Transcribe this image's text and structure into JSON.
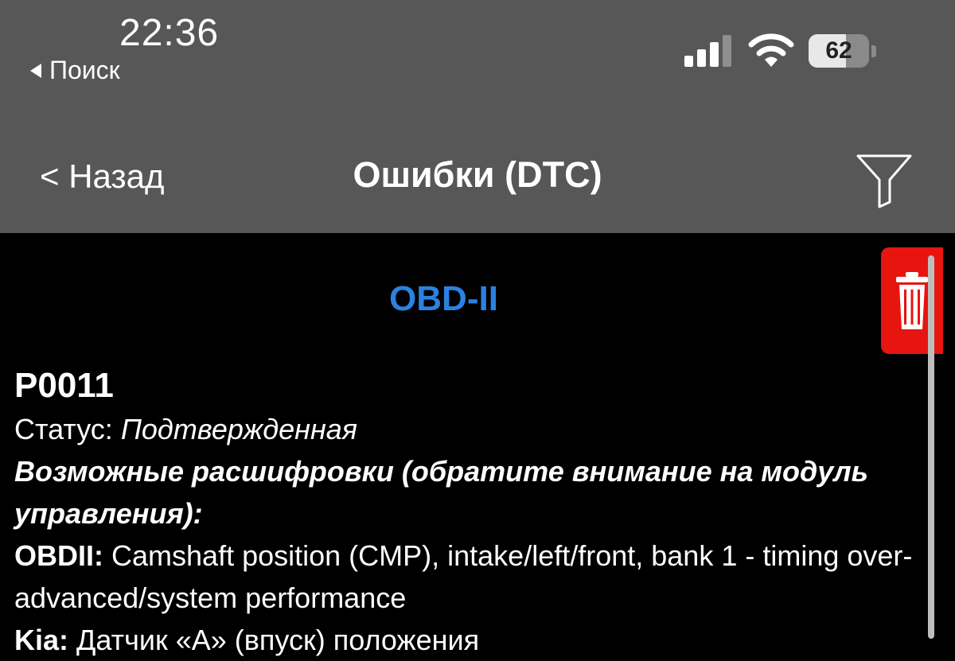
{
  "status_bar": {
    "time": "22:36",
    "back_to_app": "Поиск",
    "battery_percent": "62",
    "battery_level": 62,
    "signal_icon": "cellular-signal-icon",
    "wifi_icon": "wifi-icon"
  },
  "nav": {
    "back_label": "< Назад",
    "title": "Ошибки (DTC)",
    "filter_icon": "filter-icon"
  },
  "section": {
    "title": "OBD-II"
  },
  "delete_icon": "trash-icon",
  "dtc": {
    "code": "P0011",
    "status_label": "Статус:",
    "status_value": "Подтвержденная",
    "decodings_heading": "Возможные расшифровки (обратите внимание на модуль управления):",
    "entries": [
      {
        "brand": "OBDII:",
        "text": "Camshaft position (CMP), intake/left/front, bank 1 - timing over-advanced/system performance"
      },
      {
        "brand": "Kia:",
        "text": "Датчик «А» (впуск) положения"
      }
    ]
  },
  "colors": {
    "topbar_bg": "#575757",
    "content_bg": "#000000",
    "accent_blue": "#2a82e0",
    "delete_red": "#e8140f"
  }
}
